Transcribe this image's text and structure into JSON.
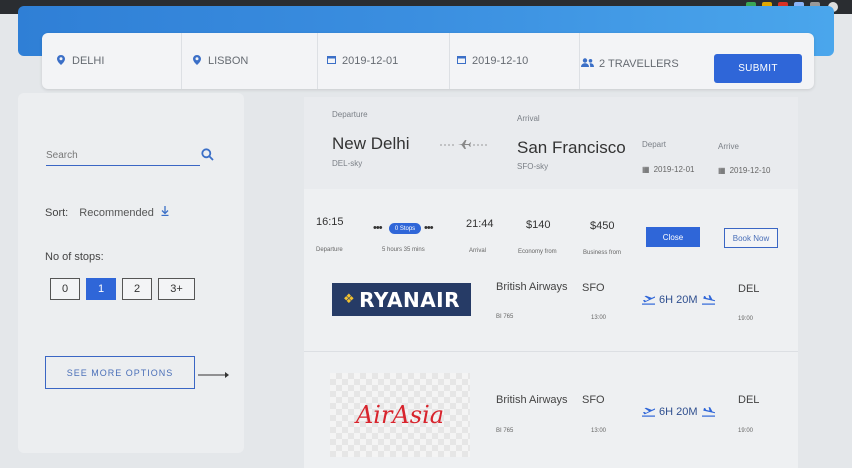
{
  "search": {
    "from": "DELHI",
    "to": "LISBON",
    "depart_date": "2019-12-01",
    "return_date": "2019-12-10",
    "travellers": "2 TRAVELLERS",
    "submit_label": "SUBMIT"
  },
  "sidebar": {
    "search_placeholder": "Search",
    "sort_label": "Sort:",
    "sort_value": "Recommended",
    "stops_label": "No of stops:",
    "stops_options": [
      "0",
      "1",
      "2",
      "3+"
    ],
    "stops_selected": "1",
    "more_options_label": "SEE MORE OPTIONS"
  },
  "route": {
    "departure_label": "Departure",
    "arrival_label": "Arrival",
    "from_city": "New Delhi",
    "from_code": "DEL-sky",
    "to_city": "San Francisco",
    "to_code": "SFO-sky",
    "depart_label": "Depart",
    "arrive_label": "Arrive",
    "depart_date": "2019-12-01",
    "arrive_date": "2019-12-10"
  },
  "summary": {
    "dep_time": "16:15",
    "dep_label": "Departure",
    "stops_pill": "0 Stops",
    "duration": "5 hours 35 mins",
    "arr_time": "21:44",
    "arr_label": "Arrival",
    "economy_price": "$140",
    "economy_label": "Economy from",
    "business_price": "$450",
    "business_label": "Business from",
    "close_label": "Close",
    "book_label": "Book Now"
  },
  "flights": [
    {
      "logo": "RYANAIR",
      "airline": "British Airways",
      "flight_no": "BI 765",
      "origin": "SFO",
      "origin_time": "13:00",
      "duration": "6H 20M",
      "destination": "DEL",
      "dest_time": "19:00"
    },
    {
      "logo": "AirAsia",
      "airline": "British Airways",
      "flight_no": "BI 765",
      "origin": "SFO",
      "origin_time": "13:00",
      "duration": "6H 20M",
      "destination": "DEL",
      "dest_time": "19:00"
    }
  ],
  "colors": {
    "accent": "#2f66d8",
    "hero": "#3b8fe0",
    "ryanair_bg": "#263b66",
    "airasia_red": "#d8242d"
  }
}
